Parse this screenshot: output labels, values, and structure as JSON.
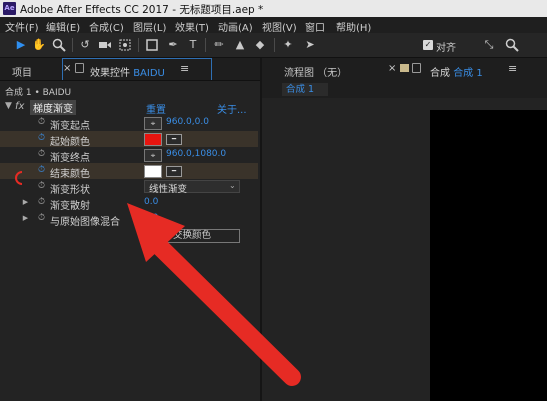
{
  "titlebar": {
    "logo": "Ae",
    "title": "Adobe After Effects CC 2017 - 无标题项目.aep *"
  },
  "menu": [
    "文件(F)",
    "编辑(E)",
    "合成(C)",
    "图层(L)",
    "效果(T)",
    "动画(A)",
    "视图(V)",
    "窗口",
    "帮助(H)"
  ],
  "toolbar": {
    "align_label": "对齐",
    "tools": [
      "selection-icon",
      "hand-icon",
      "zoom-icon",
      "rotate-icon",
      "camera-icon",
      "pan-behind-icon",
      "rectangle-icon",
      "pen-icon",
      "type-icon",
      "brush-icon",
      "clone-stamp-icon",
      "eraser-icon",
      "roto-brush-icon",
      "puppet-pin-icon"
    ]
  },
  "left_panel": {
    "tab_project": "项目",
    "tab_effects_prefix": "效果控件",
    "tab_effects_layer": "BAIDU",
    "breadcrumb": "合成 1 • BAIDU",
    "effect": {
      "fx": "fx",
      "name": "梯度渐变",
      "reset": "重置",
      "about": "关于..."
    },
    "properties": {
      "start_point": {
        "label": "渐变起点",
        "value": "960.0,0.0"
      },
      "start_color": {
        "label": "起始颜色",
        "color": "#e8150f"
      },
      "end_point": {
        "label": "渐变终点",
        "value": "960.0,1080.0"
      },
      "end_color": {
        "label": "结束颜色",
        "color": "#ffffff"
      },
      "shape": {
        "label": "渐变形状",
        "value": "线性渐变"
      },
      "scatter": {
        "label": "渐变散射",
        "value": "0.0"
      },
      "blend": {
        "label": "与原始图像混合",
        "value": "0.0"
      },
      "swap_button": "交换颜色"
    }
  },
  "right_panel": {
    "tab_flowchart": "流程图 （无）",
    "tab_comp_prefix": "合成",
    "tab_comp_name": "合成 1",
    "crumb": "合成 1"
  },
  "colors": {
    "accent": "#2f8ff0",
    "arrow": "#e62b24"
  }
}
